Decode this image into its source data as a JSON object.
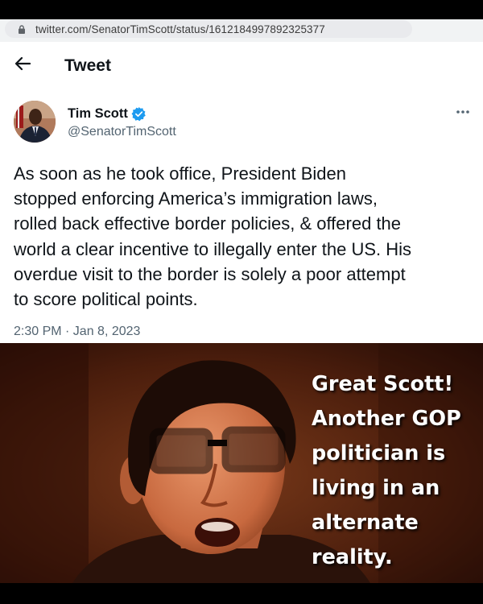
{
  "browser": {
    "url": "twitter.com/SenatorTimScott/status/1612184997892325377",
    "lock_icon": "lock-icon"
  },
  "header": {
    "title": "Tweet",
    "back_icon": "arrow-left-icon"
  },
  "tweet": {
    "author_name": "Tim Scott",
    "handle": "@SenatorTimScott",
    "verified_color": "#1d9bf0",
    "body_lines": [
      "As soon as he took office, President Biden",
      "stopped enforcing America’s immigration laws,",
      "rolled back effective border policies, & offered the",
      "world a clear incentive to illegally enter the US. His",
      "overdue visit to the border is solely a poor attempt",
      "to score political points."
    ],
    "timestamp": "2:30 PM · Jan 8, 2023",
    "more_icon": "more-horizontal-icon"
  },
  "meme": {
    "caption_lines": [
      "Great Scott!",
      "Another GOP",
      "politician is",
      "living in an",
      "alternate",
      "reality."
    ]
  }
}
